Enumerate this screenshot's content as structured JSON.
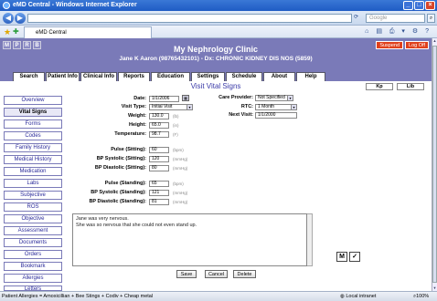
{
  "window": {
    "title": "eMD Central - Windows Internet Explorer",
    "address": "",
    "search_placeholder": "Google",
    "tab_title": "eMD Central"
  },
  "app": {
    "mprb": [
      "M",
      "P",
      "R",
      "B"
    ],
    "clinic_name": "My Nephrology Clinic",
    "patient_line": "Jane K Aaron (98765432101) - Dx: CHRONIC KIDNEY DIS NOS (5859)",
    "suspend_label": "Suspend",
    "logoff_label": "Log Off"
  },
  "tabs": [
    {
      "label": "Search"
    },
    {
      "label": "Patient Info"
    },
    {
      "label": "Clinical Info"
    },
    {
      "label": "Reports"
    },
    {
      "label": "Education"
    },
    {
      "label": "Settings"
    },
    {
      "label": "Schedule"
    },
    {
      "label": "About"
    },
    {
      "label": "Help"
    }
  ],
  "page": {
    "title": "Visit Vital Signs",
    "kp_label": "Kp",
    "lib_label": "Lib"
  },
  "sidebar": {
    "items": [
      {
        "label": "Overview"
      },
      {
        "label": "Vital Signs"
      },
      {
        "label": "Forms"
      },
      {
        "label": "Codes"
      },
      {
        "label": "Family History"
      },
      {
        "label": "Medical History"
      },
      {
        "label": "Medication"
      },
      {
        "label": "Labs"
      },
      {
        "label": "Subjective"
      },
      {
        "label": "ROS"
      },
      {
        "label": "Objective"
      },
      {
        "label": "Assessment"
      },
      {
        "label": "Documents"
      },
      {
        "label": "Orders"
      },
      {
        "label": "Bookmark"
      },
      {
        "label": "Allergies"
      },
      {
        "label": "Letters"
      }
    ]
  },
  "form": {
    "date_label": "Date:",
    "date_value": "1/1/2006",
    "visit_type_label": "Visit Type:",
    "visit_type_value": "Initial Visit",
    "weight_label": "Weight:",
    "weight_value": "130.0",
    "weight_unit": "(lb)",
    "height_label": "Height:",
    "height_value": "65.0",
    "height_unit": "(in)",
    "temperature_label": "Temperature:",
    "temperature_value": "98.7",
    "temperature_unit": "(F)",
    "care_provider_label": "Care Provider:",
    "care_provider_value": "Not Specified",
    "rtc_label": "RTC:",
    "rtc_value": "1 Month",
    "next_visit_label": "Next Visit:",
    "next_visit_value": "1/1/2000",
    "pulse_sitting_label": "Pulse (Sitting):",
    "pulse_sitting_value": "60",
    "pulse_unit": "(bpm)",
    "bp_sys_sitting_label": "BP Systolic (Sitting):",
    "bp_sys_sitting_value": "120",
    "bp_dia_sitting_label": "BP Diastolic (Sitting):",
    "bp_dia_sitting_value": "80",
    "mmhg_unit": "(mmHg)",
    "pulse_standing_label": "Pulse (Standing):",
    "pulse_standing_value": "65",
    "bp_sys_standing_label": "BP Systolic (Standing):",
    "bp_sys_standing_value": "121",
    "bp_dia_standing_label": "BP Diastolic (Standing):",
    "bp_dia_standing_value": "81",
    "notes_line1": "Jane was very nervous.",
    "notes_line2": "She was so nervous that she could not even stand up.",
    "m_button": "M",
    "save_label": "Save",
    "cancel_label": "Cancel",
    "delete_label": "Delete"
  },
  "status": {
    "allergies": "Patient Allergies = Amoxicillian + Bee Stings + Codiv + Cheap metal",
    "zone": "Local intranet",
    "zoom": "100%"
  }
}
